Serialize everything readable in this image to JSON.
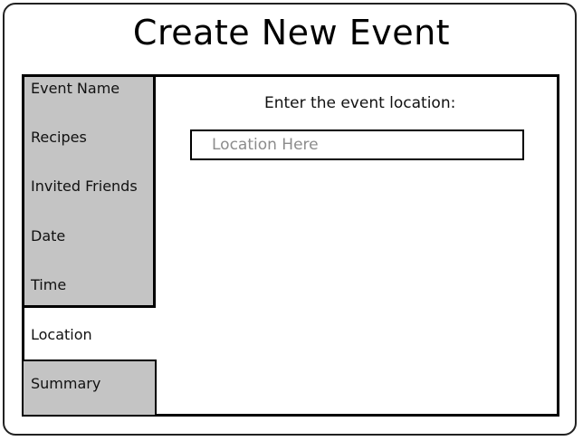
{
  "window": {
    "title": "Create New Event"
  },
  "sidebar": {
    "items": [
      {
        "label": "Event Name",
        "state": "inactive"
      },
      {
        "label": "Recipes",
        "state": "inactive"
      },
      {
        "label": "Invited Friends",
        "state": "inactive"
      },
      {
        "label": "Date",
        "state": "inactive"
      },
      {
        "label": "Time",
        "state": "inactive"
      },
      {
        "label": "Location",
        "state": "active"
      },
      {
        "label": "Summary",
        "state": "inactive"
      }
    ]
  },
  "main": {
    "prompt": "Enter the event location:",
    "location_input": {
      "value": "",
      "placeholder": "Location Here"
    }
  },
  "colors": {
    "inactive_tab_bg": "#c4c4c4",
    "active_tab_bg": "#ffffff",
    "border": "#000000",
    "placeholder_text": "#8c8c8c"
  }
}
